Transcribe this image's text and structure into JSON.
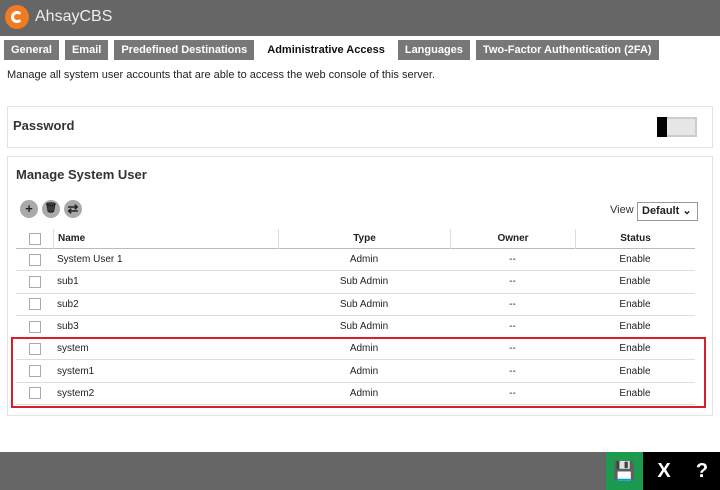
{
  "app": {
    "title": "AhsayCBS"
  },
  "tabs": [
    {
      "label": "General"
    },
    {
      "label": "Email"
    },
    {
      "label": "Predefined Destinations"
    },
    {
      "label": "Administrative Access",
      "active": true
    },
    {
      "label": "Languages"
    },
    {
      "label": "Two-Factor Authentication (2FA)"
    }
  ],
  "description": "Manage all system user accounts that are able to access the web console of this server.",
  "password": {
    "title": "Password",
    "enabled": false
  },
  "manage": {
    "title": "Manage System User",
    "view_label": "View",
    "view_value": "Default",
    "icons": {
      "add": "+",
      "delete": "🗑",
      "filter": "⇄"
    },
    "columns": {
      "name": "Name",
      "type": "Type",
      "owner": "Owner",
      "status": "Status"
    },
    "rows": [
      {
        "name": "System User 1",
        "type": "Admin",
        "owner": "--",
        "status": "Enable"
      },
      {
        "name": "sub1",
        "type": "Sub Admin",
        "owner": "--",
        "status": "Enable"
      },
      {
        "name": "sub2",
        "type": "Sub Admin",
        "owner": "--",
        "status": "Enable"
      },
      {
        "name": "sub3",
        "type": "Sub Admin",
        "owner": "--",
        "status": "Enable"
      },
      {
        "name": "system",
        "type": "Admin",
        "owner": "--",
        "status": "Enable"
      },
      {
        "name": "system1",
        "type": "Admin",
        "owner": "--",
        "status": "Enable"
      },
      {
        "name": "system2",
        "type": "Admin",
        "owner": "--",
        "status": "Enable"
      }
    ]
  },
  "footer": {
    "save": "💾",
    "close": "X",
    "help": "?"
  }
}
